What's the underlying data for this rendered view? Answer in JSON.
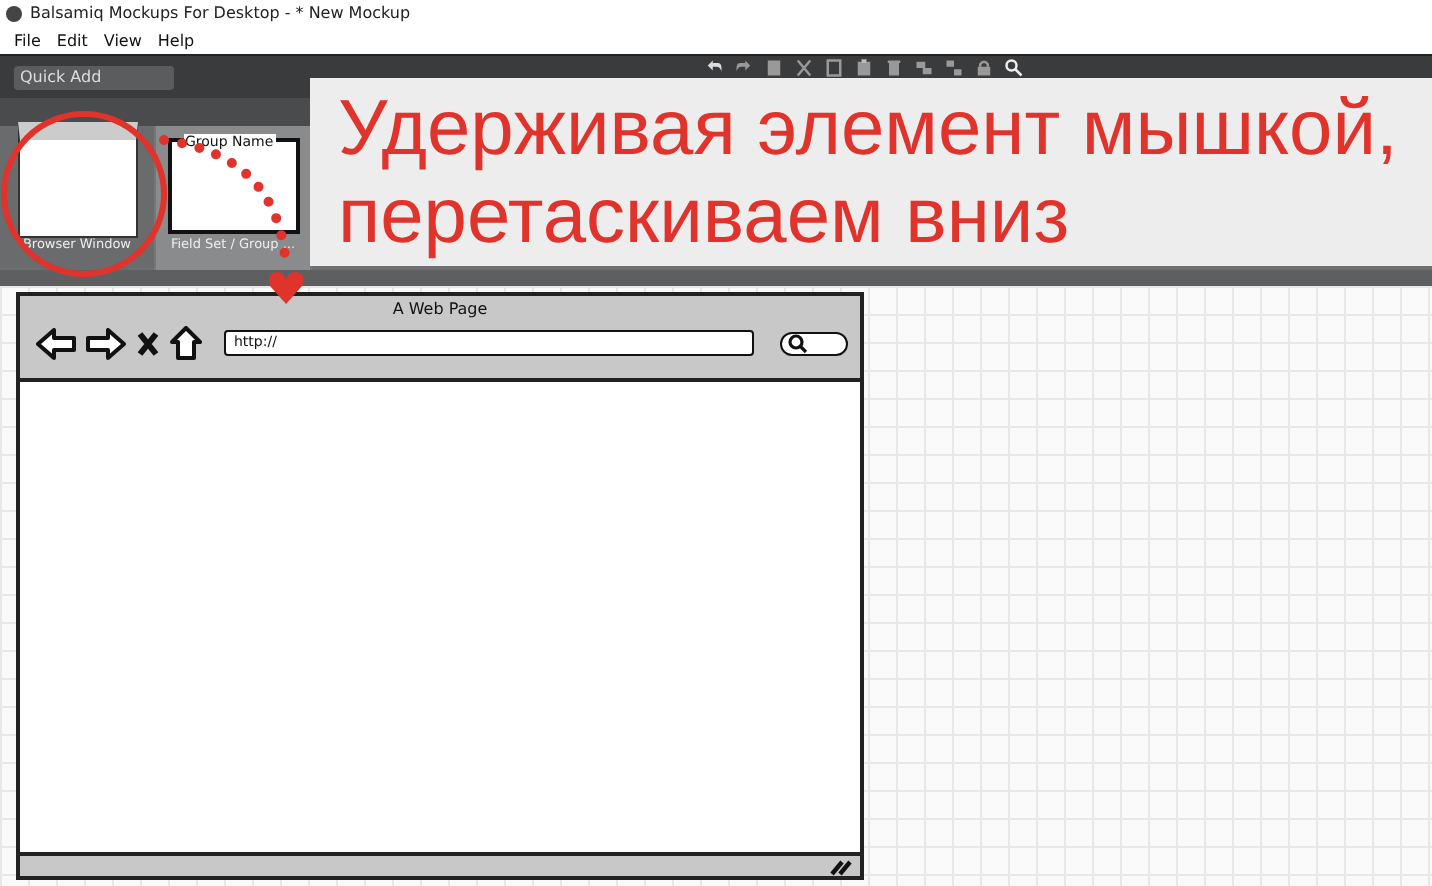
{
  "window": {
    "title": "Balsamiq Mockups For Desktop - * New Mockup"
  },
  "menu": [
    "File",
    "Edit",
    "View",
    "Help"
  ],
  "quick_add": {
    "placeholder": "Quick Add"
  },
  "library": [
    {
      "label": "Browser Window",
      "kind": "browser",
      "selected": true
    },
    {
      "label": "Field Set / Group ...",
      "kind": "fieldset",
      "selected": false
    }
  ],
  "thumb_texts": {
    "group_name": "Group Name"
  },
  "annotation": {
    "lines": [
      "Удерживая элемент мышкой,",
      "перетаскиваем вниз"
    ]
  },
  "mockup": {
    "title": "A Web Page",
    "url": "http://"
  }
}
